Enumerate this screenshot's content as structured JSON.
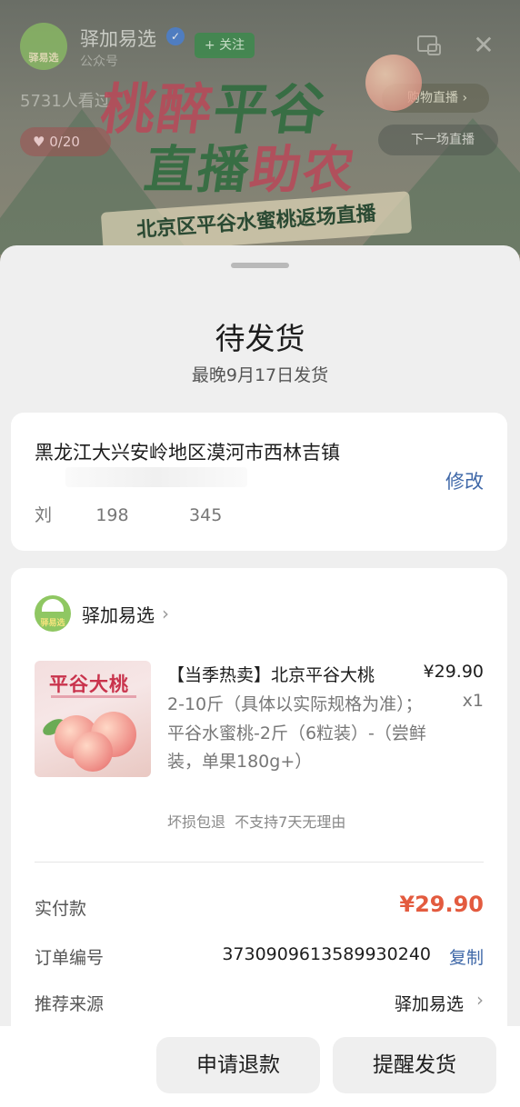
{
  "live_header": {
    "account_name": "驿加易选",
    "account_type": "公众号",
    "follow_label": "+ 关注",
    "viewers": "5731人看过",
    "likes": "0/20",
    "shop_pill": "购物直播",
    "next_live": "下一场直播",
    "banner_line1_a": "桃醉",
    "banner_line1_b": "平谷",
    "banner_line2_a": "直播",
    "banner_line2_b": "助农",
    "banner_subtitle": "北京区平谷水蜜桃返场直播",
    "logo_text": "驿易选"
  },
  "sheet": {
    "title": "待发货",
    "subtitle": "最晚9月17日发货"
  },
  "address": {
    "line": "黑龙江大兴安岭地区漠河市西林吉镇",
    "edit_label": "修改",
    "contact": "刘        198           345"
  },
  "order": {
    "shop_name": "驿加易选",
    "shop_logo_text": "驿易选",
    "product_image_title": "平谷大桃",
    "product_title": "【当季热卖】北京平谷大桃",
    "price": "¥29.90",
    "spec": "2-10斤（具体以实际规格为准）；平谷水蜜桃-2斤（6粒装）-（尝鲜装，单果180g+）",
    "quantity": "x1",
    "tags": "坏损包退  不支持7天无理由",
    "paid_label": "实付款",
    "paid_value": "¥29.90",
    "order_no_label": "订单编号",
    "order_no_value": "3730909613589930240",
    "copy_label": "复制",
    "source_label": "推荐来源",
    "source_value": "驿加易选"
  },
  "actions": {
    "refund_label": "申请退款",
    "remind_label": "提醒发货"
  },
  "colors": {
    "accent_blue": "#3f68a8",
    "price_red": "#e35b3f",
    "brand_green": "#8fc762"
  }
}
